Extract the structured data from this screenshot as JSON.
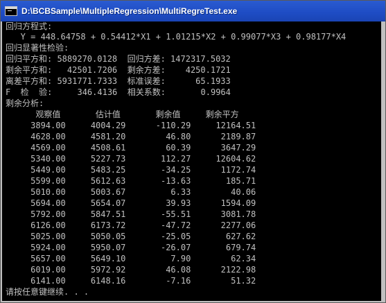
{
  "window": {
    "title": "D:\\BCBSample\\MultipleRegression\\MultiRegreTest.exe",
    "icon": "console-app-icon"
  },
  "console": {
    "text_color": "#c0c0c0",
    "background": "#000000",
    "lines": [
      "回归方程式:",
      "   Y = 448.64758 + 0.54412*X1 + 1.01215*X2 + 0.99077*X3 + 0.98177*X4",
      "回归显著性检验:",
      "回归平方和: 5889270.0128  回归方差: 1472317.5032",
      "剩余平方和:   42501.7206  剩余方差:    4250.1721",
      "离差平方和: 5931771.7333  标准误差:      65.1933",
      "F  检  验:     346.4136  相关系数:       0.9964",
      "剩余分析:",
      "      观察值       估计值       剩余值     剩余平方",
      "     3894.00     4004.29      -110.29     12164.51",
      "     4628.00     4581.20        46.80      2189.87",
      "     4569.00     4508.61        60.39      3647.29",
      "     5340.00     5227.73       112.27     12604.62",
      "     5449.00     5483.25       -34.25      1172.74",
      "     5599.00     5612.63       -13.63       185.71",
      "     5010.00     5003.67         6.33        40.06",
      "     5694.00     5654.07        39.93      1594.09",
      "     5792.00     5847.51       -55.51      3081.78",
      "     6126.00     6173.72       -47.72      2277.06",
      "     5025.00     5050.05       -25.05       627.62",
      "     5924.00     5950.07       -26.07       679.74",
      "     5657.00     5649.10         7.90        62.34",
      "     6019.00     5972.92        46.08      2122.98",
      "     6141.00     6148.16        -7.16        51.32",
      "请按任意键继续. . ."
    ]
  }
}
